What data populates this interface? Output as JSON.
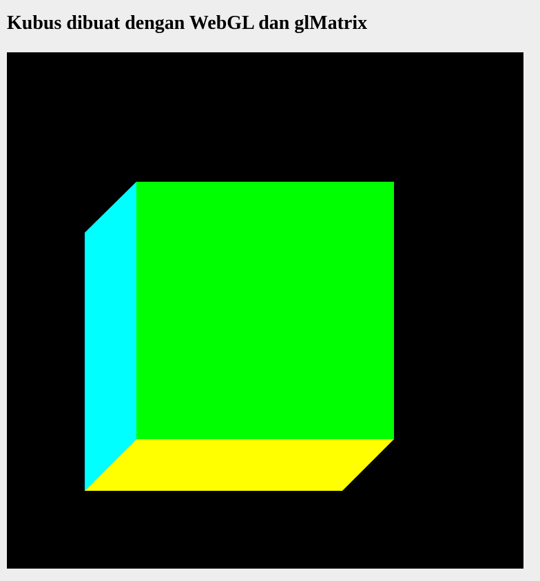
{
  "page": {
    "title": "Kubus dibuat dengan WebGL dan glMatrix"
  },
  "canvas": {
    "background": "#000000",
    "cube": {
      "faces": [
        {
          "name": "front",
          "color": "#00ff00"
        },
        {
          "name": "left",
          "color": "#00ffff"
        },
        {
          "name": "bottom",
          "color": "#ffff00"
        }
      ]
    }
  }
}
